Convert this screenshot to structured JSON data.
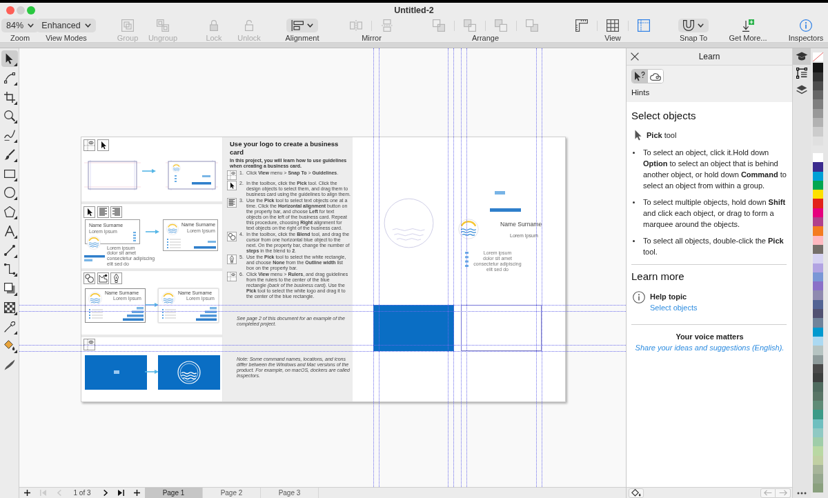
{
  "window": {
    "title": "Untitled-2"
  },
  "toolbar": [
    {
      "kind": "dropdown",
      "value": "84%",
      "label": "Zoom"
    },
    {
      "kind": "dropdown",
      "value": "Enhanced",
      "label": "View Modes"
    },
    {
      "kind": "button",
      "label": "Group",
      "disabled": true
    },
    {
      "kind": "button",
      "label": "Ungroup",
      "disabled": true
    },
    {
      "kind": "button",
      "label": "Lock",
      "disabled": true
    },
    {
      "kind": "button",
      "label": "Unlock",
      "disabled": true
    },
    {
      "kind": "icon-dropdown",
      "label": "Alignment"
    },
    {
      "kind": "set",
      "label": "Mirror",
      "buttons": [
        {
          "disabled": true,
          "on": false
        },
        {
          "disabled": true,
          "on": false
        }
      ]
    },
    {
      "kind": "set",
      "label": "Arrange",
      "buttons": [
        {
          "disabled": true,
          "on": false
        },
        {
          "disabled": true,
          "on": false
        },
        {
          "disabled": true,
          "on": false
        },
        {
          "disabled": true,
          "on": false
        }
      ]
    },
    {
      "kind": "set",
      "label": "View",
      "buttons": [
        {
          "disabled": false,
          "on": false
        },
        {
          "disabled": false,
          "on": false
        },
        {
          "disabled": false,
          "on": true
        }
      ]
    },
    {
      "kind": "icon-dropdown",
      "label": "Snap To"
    },
    {
      "kind": "button",
      "label": "Get More...",
      "disabled": false
    },
    {
      "kind": "button",
      "label": "Inspectors",
      "disabled": false
    }
  ],
  "toolbox": {
    "tools": [
      {
        "selected": true
      },
      {
        "selected": false
      },
      {
        "selected": false
      },
      {
        "selected": false
      },
      {
        "selected": false
      },
      {
        "selected": false
      },
      {
        "selected": false
      },
      {
        "selected": false
      },
      {
        "selected": false
      },
      {
        "selected": false
      },
      {
        "selected": false
      },
      {
        "selected": false
      },
      {
        "selected": false
      },
      {
        "selected": false
      },
      {
        "selected": false
      },
      {
        "selected": false
      },
      {
        "selected": false
      }
    ]
  },
  "document": {
    "thumbnails": [
      {
        "kind": "guides"
      },
      {
        "kind": "align",
        "before": {
          "name": "Name Surname",
          "subtitle": "Lorem Ipsum",
          "note_lines": [
            "Lorem ipsum",
            "dolor sit amet",
            "consectetur adipiscing",
            "elit sed do"
          ]
        },
        "after": {
          "name": "Name Surname",
          "subtitle": "Lorem Ipsum"
        }
      },
      {
        "kind": "blend",
        "before": {
          "name": "Name Surname",
          "subtitle": "Lorem Ipsum"
        },
        "after": {
          "name": "Name Surname",
          "subtitle": "Lorem Ipsum"
        }
      },
      {
        "kind": "logo"
      }
    ],
    "instructions": {
      "title": "Use your logo to create a business card",
      "intro": "In this project, you will learn how to use guidelines when creating a business card.",
      "steps": [
        {
          "number": "1.",
          "text": "Click **View** menu > **Snap To** > **Guidelines**."
        },
        {
          "number": "2.",
          "text": "In the toolbox, click the **Pick** tool. Click the design objects to select them, and drag them to business card using the guidelines to align them."
        },
        {
          "number": "3.",
          "text": "Use the **Pick** tool to select text objects one at a time. Click the **Horizontal alignment** button on the property bar, and choose **Left** for text objects on the left of the business card. Repeat this procedure, choosing **Right** alignment for text objects on the right of the business card."
        },
        {
          "number": "4.",
          "text": "In the toolbox, click the **Blend** tool, and drag the cursor from one horizontal blue object to the next. On the property bar, change the number of **steps** in the blend to **2**."
        },
        {
          "number": "5.",
          "text": "Use the **Pick** tool to select the white rectangle, and choose **None** from the **Outline width** list box on the property bar."
        },
        {
          "number": "6.",
          "text": "Click **View** menu > **Rulers**, and drag guidelines from the rulers to the center of the blue rectangle *(back of the business card)*. Use the **Pick** tool to select the white logo and drag it to the center of the blue rectangle."
        }
      ],
      "notes": [
        "See page 2 of this document for an example of the completed project.",
        "Note: Some command names, locations, and icons differ between the Windows and Mac versions of the product. For example, on macOS, dockers are called inspectors."
      ]
    },
    "card_design": {
      "name": "Name Surname",
      "subtitle": "Lorem Ipsum",
      "note_lines": [
        "Lorem ipsum",
        "dolor sit amet",
        "consectetur adipiscing",
        "elit sed do"
      ]
    }
  },
  "pages": {
    "nav": [
      {
        "disabled": false
      },
      {
        "disabled": true
      },
      {
        "disabled": true
      },
      {
        "disabled": false
      },
      {
        "disabled": false
      },
      {
        "disabled": false
      }
    ],
    "counter": "1 of 3",
    "tabs": [
      {
        "label": "Page 1",
        "selected": true
      },
      {
        "label": "Page 2",
        "selected": false
      },
      {
        "label": "Page 3",
        "selected": false
      }
    ]
  },
  "learn_panel": {
    "title": "Learn",
    "modes": [
      {
        "selected": true
      },
      {
        "selected": false
      }
    ],
    "mode_label": "Hints",
    "heading": "Select objects",
    "tool": "**Pick** tool",
    "bullets": [
      "To select an object, click it.Hold down **Option** to select an object that is behind another object, or hold down **Command** to select an object from within a group.",
      "To select multiple objects, hold down **Shift** and click each object, or drag to form a marquee around the objects.",
      "To select all objects, double-click the **Pick** tool."
    ],
    "learn_more": {
      "heading": "Learn more",
      "topic_label": "Help topic",
      "topic_link": "Select objects"
    },
    "feedback": {
      "heading": "Your voice matters",
      "link": "Share your ideas and suggestions (English)."
    }
  },
  "inspector_tabs": [
    {
      "selected": true
    },
    {
      "selected": false
    },
    {
      "selected": false
    }
  ],
  "palette": [
    {
      "swatches": [
        {
          "kind": "none"
        }
      ]
    },
    {
      "swatches": [
        {
          "kind": "color",
          "color": "#151515"
        },
        {
          "kind": "color",
          "color": "#333333"
        },
        {
          "kind": "color",
          "color": "#4d4d4d"
        },
        {
          "kind": "color",
          "color": "#666666"
        },
        {
          "kind": "color",
          "color": "#7f7f7f"
        },
        {
          "kind": "color",
          "color": "#999999"
        },
        {
          "kind": "color",
          "color": "#b2b2b2"
        },
        {
          "kind": "color",
          "color": "#cccccc"
        },
        {
          "kind": "color",
          "color": "#e0e0e0"
        }
      ]
    },
    {
      "swatches": [
        {
          "kind": "color",
          "color": "#ffffff"
        },
        {
          "kind": "color",
          "color": "#3b2b8e"
        },
        {
          "kind": "color",
          "color": "#00a0d6"
        },
        {
          "kind": "color",
          "color": "#00a650"
        },
        {
          "kind": "color",
          "color": "#fde100"
        },
        {
          "kind": "color",
          "color": "#e2231a"
        },
        {
          "kind": "color",
          "color": "#e6007e"
        },
        {
          "kind": "color",
          "color": "#b0418c"
        },
        {
          "kind": "color",
          "color": "#f47c20"
        },
        {
          "kind": "color",
          "color": "#ffb9c0"
        },
        {
          "kind": "color",
          "color": "#756f6a"
        },
        {
          "kind": "color",
          "color": "#d6d3f2"
        },
        {
          "kind": "color",
          "color": "#b1a3e2"
        },
        {
          "kind": "color",
          "color": "#7a97d6"
        },
        {
          "kind": "color",
          "color": "#8a70c8"
        },
        {
          "kind": "color",
          "color": "#8f8aaf"
        },
        {
          "kind": "color",
          "color": "#536494"
        },
        {
          "kind": "color",
          "color": "#525272"
        },
        {
          "kind": "color",
          "color": "#70839a"
        },
        {
          "kind": "color",
          "color": "#0099cf"
        },
        {
          "kind": "color",
          "color": "#abd9f2"
        },
        {
          "kind": "color",
          "color": "#b6c4c2"
        },
        {
          "kind": "color",
          "color": "#8e9b9b"
        },
        {
          "kind": "color",
          "color": "#4a4a4a"
        },
        {
          "kind": "color",
          "color": "#3c3f3e"
        },
        {
          "kind": "color",
          "color": "#4f6b5f"
        },
        {
          "kind": "color",
          "color": "#597566"
        },
        {
          "kind": "color",
          "color": "#5f8b76"
        },
        {
          "kind": "color",
          "color": "#3b9a87"
        },
        {
          "kind": "color",
          "color": "#6fbfbf"
        },
        {
          "kind": "color",
          "color": "#8fc9c3"
        },
        {
          "kind": "color",
          "color": "#9fcda9"
        },
        {
          "kind": "color",
          "color": "#b9d8a3"
        },
        {
          "kind": "color",
          "color": "#c1d0a3"
        },
        {
          "kind": "color",
          "color": "#a7b59a"
        },
        {
          "kind": "color",
          "color": "#96a88e"
        },
        {
          "kind": "color",
          "color": "#8aa07e"
        }
      ]
    }
  ]
}
